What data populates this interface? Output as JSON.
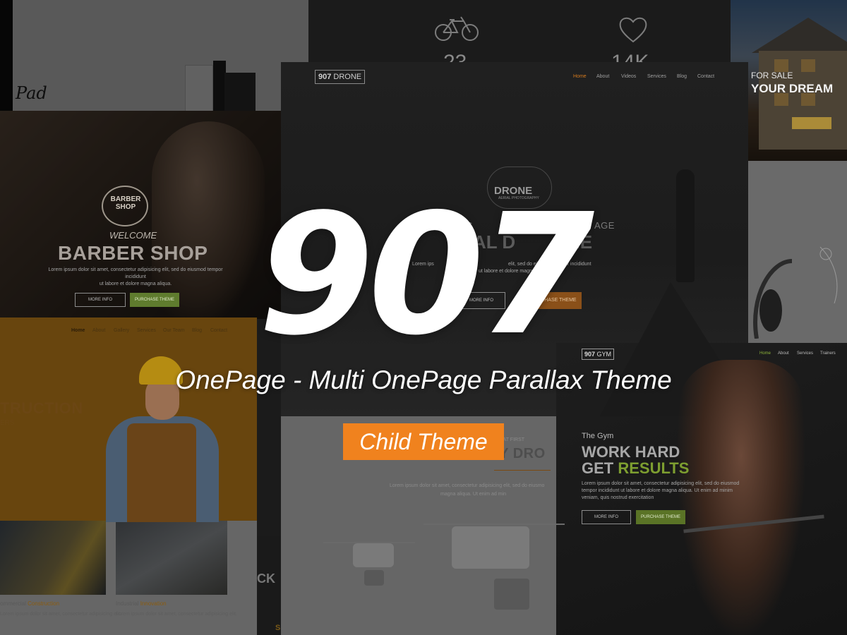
{
  "hero": {
    "title": "907",
    "subtitle": "OnePage - Multi OnePage Parallax Theme",
    "badge": "Child Theme"
  },
  "colors": {
    "accent_orange": "#f0821e",
    "gym_green": "#7d9e30",
    "drone_orange": "#d47a1e",
    "background": "#1b1b1b"
  },
  "icons": [
    "bicycle-icon",
    "heart-icon",
    "headphones-icon"
  ],
  "top_stats": {
    "bike_count": "23",
    "heart_count": "14K"
  },
  "house": {
    "pre": "FOR SALE",
    "title": "YOUR DREAM"
  },
  "barber": {
    "logo_line1": "BARBER",
    "logo_line2": "SHOP",
    "welcome": "WELCOME",
    "title": "BARBER SHOP",
    "lorem1": "Lorem ipsum dolor sit amet, consectetur adipisicing elit, sed do eiusmod tempor incididunt",
    "lorem2": "ut labore et dolore magna aliqua.",
    "more_info": "MORE INFO",
    "purchase": "PURCHASE THEME"
  },
  "drone": {
    "logo_num": "907",
    "logo_word": "DRONE",
    "nav": [
      "Home",
      "About",
      "Videos",
      "Services",
      "Blog",
      "Contact"
    ],
    "badge": "DRONE",
    "badge_sub": "AERIAL PHOTOGRAPHY",
    "headline_a": "PROG",
    "headline_b": "AGE",
    "title_a": "RIAL D",
    "title_b": "NE",
    "lorem1": "Lorem ips",
    "lorem2": "elit, sed do eiusmod tempor incididunt",
    "lorem3": "ut labore et dolore magna aliqua.",
    "more_info": "MORE INFO",
    "purchase": "PURCHASE THEME"
  },
  "construction": {
    "nav": [
      "Home",
      "About",
      "Gallery",
      "Services",
      "Our Team",
      "Blog",
      "Contact"
    ],
    "title": "TRUCTION",
    "subtitle": "ERS",
    "caption1_a": "ommercial",
    "caption1_b": "Construction",
    "caption2_a": "Industrial",
    "caption2_b": "Innovation",
    "cap_lorem1": "Lorem ipsum dolor sit amet, consectetur adipisicing elit.",
    "cap_lorem2": "Lorem ipsum dolor sit amet, consectetur adipisicing elit."
  },
  "strip": {
    "text": "CK",
    "bottom": "S"
  },
  "drone_product": {
    "pre": "KNEW AT FIRST",
    "title": "MY DRO",
    "lorem1": "Lorem ipsum dolor sit amet, consectetur adipisicing elit, sed do eiusmo",
    "lorem2": "magna aliqua. Ut enim ad min"
  },
  "gym": {
    "logo_num": "907",
    "logo_word": "GYM",
    "nav": [
      "Home",
      "About",
      "Services",
      "Trainers"
    ],
    "pre": "The Gym",
    "line1": "WORK HARD",
    "line2_a": "GET",
    "line2_b": "RESULTS",
    "lorem1": "Lorem ipsum dolor sit amet, consectetur adipisicing elit, sed do eiusmod",
    "lorem2": "tempor incididunt ut labore et dolore magna aliqua. Ut enim ad minim",
    "lorem3": "veniam, quis nostrud exercitation",
    "more_info": "MORE INFO",
    "purchase": "PURCHASE THEME"
  }
}
